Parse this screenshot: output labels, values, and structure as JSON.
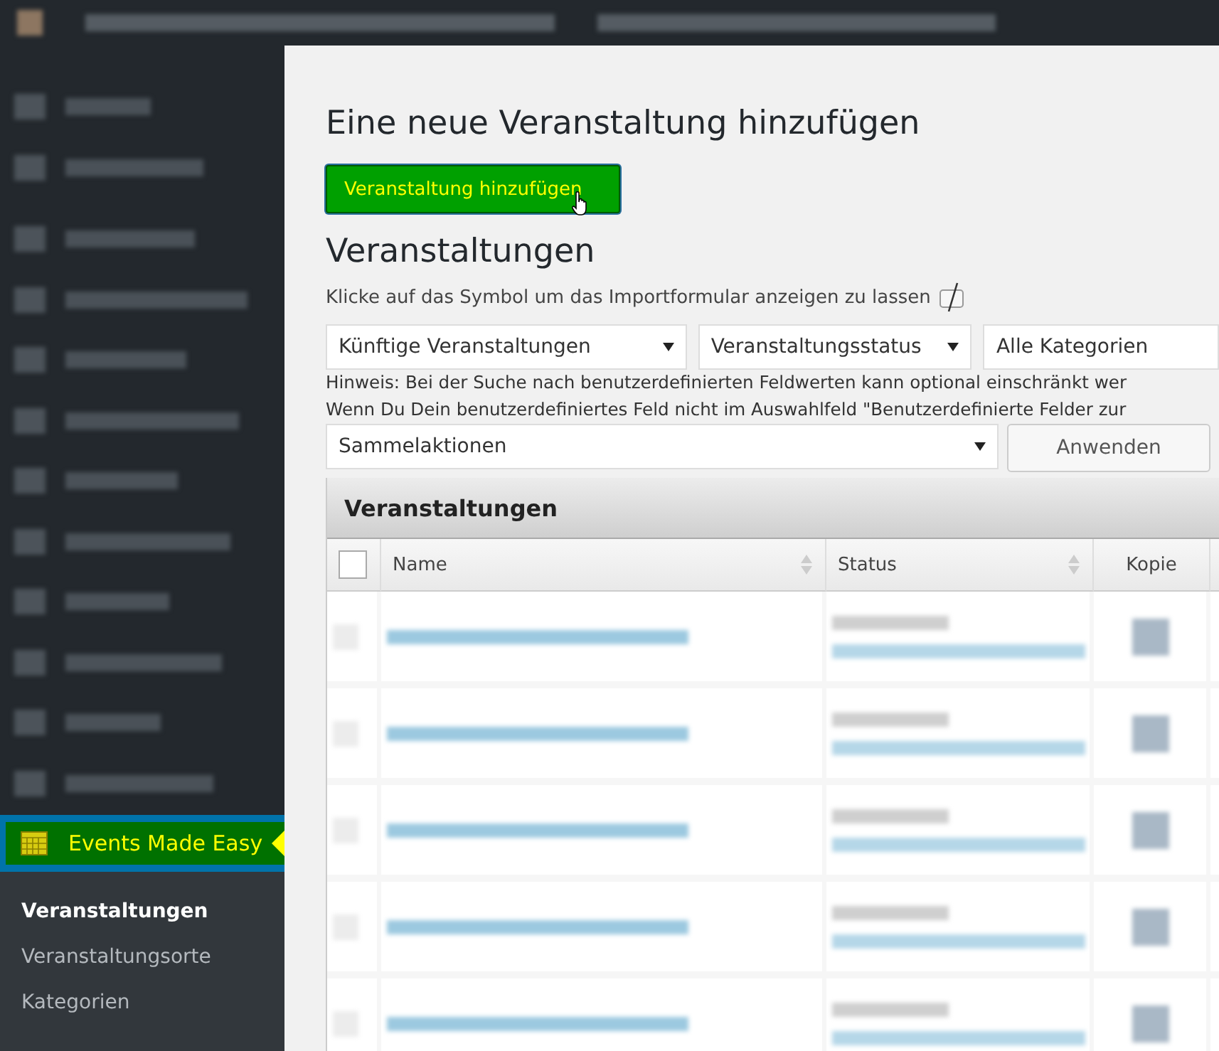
{
  "sidebar": {
    "items": [
      {
        "kind": "blurred"
      },
      {
        "kind": "blurred"
      },
      {
        "kind": "gap"
      },
      {
        "kind": "blurred"
      },
      {
        "kind": "blurred"
      },
      {
        "kind": "blurred"
      },
      {
        "kind": "blurred"
      },
      {
        "kind": "blurred"
      },
      {
        "kind": "blurred"
      },
      {
        "kind": "blurred"
      },
      {
        "kind": "blurred"
      },
      {
        "kind": "blurred"
      },
      {
        "kind": "blurred"
      },
      {
        "kind": "current",
        "label": "Events Made Easy"
      }
    ],
    "submenu": [
      {
        "label": "Veranstaltungen",
        "selected": true
      },
      {
        "label": "Veranstaltungsorte",
        "selected": false
      },
      {
        "label": "Kategorien",
        "selected": false
      }
    ]
  },
  "page": {
    "title": "Eine neue Veranstaltung hinzufügen",
    "add_button": "Veranstaltung hinzufügen",
    "section_title": "Veranstaltungen",
    "import_hint": "Klicke auf das Symbol um das Importformular anzeigen zu lassen",
    "filters": [
      "Künftige Veranstaltungen",
      "Veranstaltungsstatus",
      "Alle Kategorien"
    ],
    "notes": [
      "Hinweis: Bei der Suche nach benutzerdefinierten Feldwerten kann optional einschränkt wer",
      "Wenn Du Dein benutzerdefiniertes Feld nicht im Auswahlfeld \"Benutzerdefinierte Felder zur"
    ],
    "bulk_select": "Sammelaktionen",
    "apply_button": "Anwenden"
  },
  "table": {
    "title": "Veranstaltungen",
    "select_all_checked": false,
    "columns": [
      "Name",
      "Status",
      "Kopie"
    ],
    "rows": [
      {
        "kind": "blurred",
        "checked": false
      },
      {
        "kind": "blurred",
        "checked": false
      },
      {
        "kind": "blurred",
        "checked": false
      },
      {
        "kind": "blurred",
        "checked": false
      },
      {
        "kind": "blurred",
        "checked": false
      }
    ]
  }
}
